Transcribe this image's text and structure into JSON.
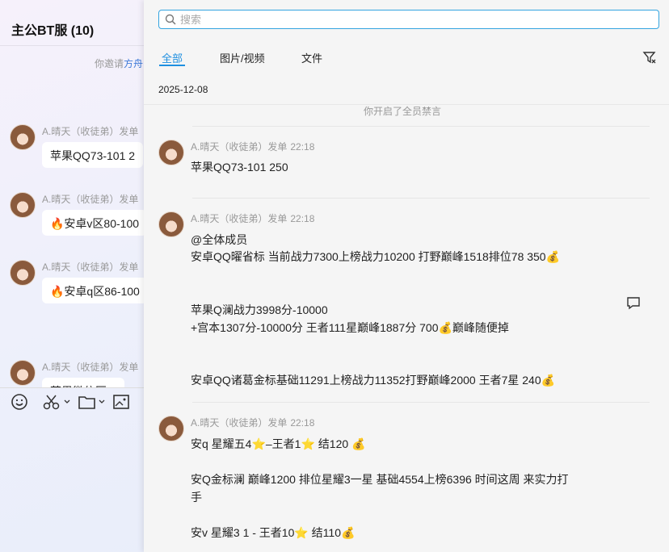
{
  "chat": {
    "title": "主公BT服 (10)",
    "invite_prefix": "你邀请",
    "invite_link": "方舟",
    "messages": [
      {
        "sender": "A.晴天（收徒弟）发单",
        "text": "苹果QQ73-101   2"
      },
      {
        "sender": "A.晴天（收徒弟）发单",
        "text": "🔥安卓v区80-100"
      },
      {
        "sender": "A.晴天（收徒弟）发单",
        "text": "🔥安卓q区86-100"
      },
      {
        "sender": "A.晴天（收徒弟）发单",
        "text": "苹果微信区..."
      }
    ],
    "toolbar": [
      "emoji-icon",
      "scissors-icon",
      "folder-icon",
      "screenshot-icon"
    ]
  },
  "panel": {
    "search_placeholder": "搜索",
    "tabs": [
      "全部",
      "图片/视频",
      "文件"
    ],
    "active_tab": "全部",
    "date": "2025-12-08",
    "system_notice": "你开启了全员禁言",
    "accent": "#1e8fe0",
    "messages": [
      {
        "sender": "A.晴天（收徒弟）发单",
        "time": "22:18",
        "lines": [
          "苹果QQ73-101    250"
        ]
      },
      {
        "sender": "A.晴天（收徒弟）发单",
        "time": "22:18",
        "lines": [
          "@全体成员",
          "安卓QQ曜省标  当前战力7300上榜战力10200  打野巅峰1518排位78  350💰",
          "",
          "苹果Q澜战力3998分-10000",
          "+宫本1307分-10000分  王者111星巅峰1887分  700💰巅峰随便掉",
          "",
          "安卓QQ诸葛金标基础11291上榜战力11352打野巅峰2000  王者7星  240💰"
        ]
      },
      {
        "sender": "A.晴天（收徒弟）发单",
        "time": "22:18",
        "lines": [
          "安q  星耀五4⭐–王者1⭐  结120  💰",
          "",
          "安Q金标澜   巅峰1200   排位星耀3一星   基础4554上榜6396   时间这周   来实力打",
          "手",
          "",
          "安v  星耀3  1  - 王者10⭐  结110💰"
        ]
      }
    ]
  }
}
